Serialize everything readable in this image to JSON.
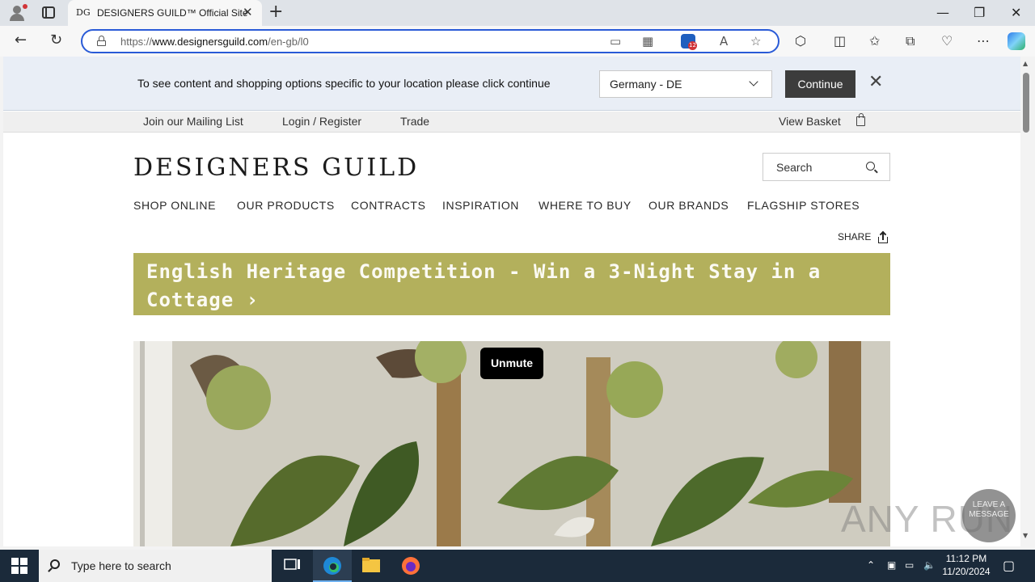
{
  "browser": {
    "tab": {
      "favicon": "DG",
      "title": "DESIGNERS GUILD™ Official Site"
    },
    "url_prefix": "https://",
    "url_host": "www.designersguild.com",
    "url_path": "/en-gb/l0",
    "extension_badge": "12",
    "icons": [
      "profile-icon",
      "tab-actions-icon",
      "close-icon",
      "new-tab-icon",
      "minimize-icon",
      "maximize-icon",
      "back-icon",
      "refresh-icon",
      "lock-icon",
      "read-aloud-icon",
      "favorite-icon",
      "extensions-icon",
      "split-screen-icon",
      "favorites-icon",
      "collections-icon",
      "performance-icon",
      "more-icon",
      "copilot-icon"
    ]
  },
  "location_banner": {
    "message": "To see content and shopping options specific to your location please click continue",
    "selected_country": "Germany - DE",
    "continue_label": "Continue"
  },
  "utility_nav": {
    "mailing": "Join our Mailing List",
    "login": "Login / Register",
    "trade": "Trade",
    "basket": "View Basket"
  },
  "header": {
    "logo": "DESIGNERS GUILD",
    "search_placeholder": "Search"
  },
  "main_nav": [
    "SHOP ONLINE",
    "OUR PRODUCTS",
    "CONTRACTS",
    "INSPIRATION",
    "WHERE TO BUY",
    "OUR BRANDS",
    "FLAGSHIP STORES"
  ],
  "share_label": "SHARE",
  "promo": {
    "text": "English Heritage Competition - Win a 3-Night Stay in a Cottage ›"
  },
  "hero": {
    "unmute_label": "Unmute"
  },
  "overlay": {
    "watermark": "ANY RUN",
    "leave_message": "LEAVE A MESSAGE"
  },
  "taskbar": {
    "search_placeholder": "Type here to search",
    "time": "11:12 PM",
    "date": "11/20/2024"
  },
  "colors": {
    "promo_bg": "#b3b05c",
    "continue_bg": "#3c3c3c",
    "banner_bg": "#e9eef6",
    "taskbar_bg": "#1b2a3a"
  }
}
